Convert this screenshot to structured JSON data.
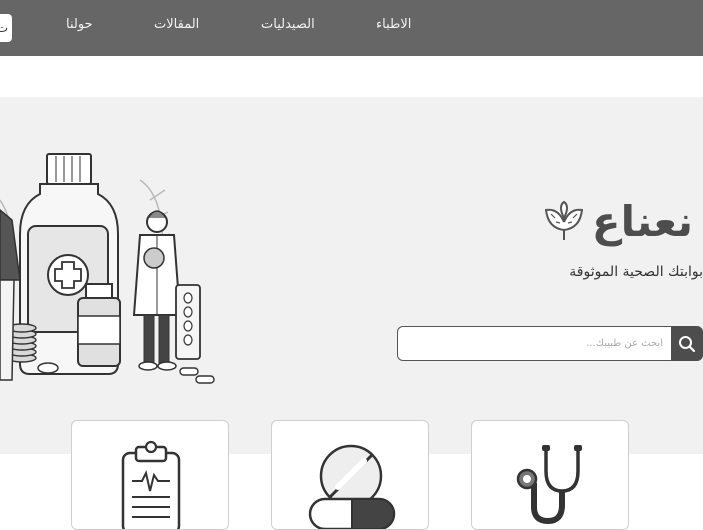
{
  "nav": {
    "items": [
      {
        "label": "الاطباء"
      },
      {
        "label": "الصيدليات"
      },
      {
        "label": "المقالات"
      },
      {
        "label": "حولنا"
      }
    ],
    "edge_button_label": "ت"
  },
  "hero": {
    "brand_name": "نعناع",
    "tagline": "بوابتك الصحية الموثوقة",
    "search": {
      "placeholder": "ابحث عن طبيبك..."
    }
  },
  "cards": [
    {
      "icon": "clipboard-icon"
    },
    {
      "icon": "pill-icon"
    },
    {
      "icon": "stethoscope-icon"
    }
  ],
  "colors": {
    "topbar": "#666666",
    "hero_bg": "#f1f1f1",
    "accent_dark": "#4d4d4d"
  }
}
